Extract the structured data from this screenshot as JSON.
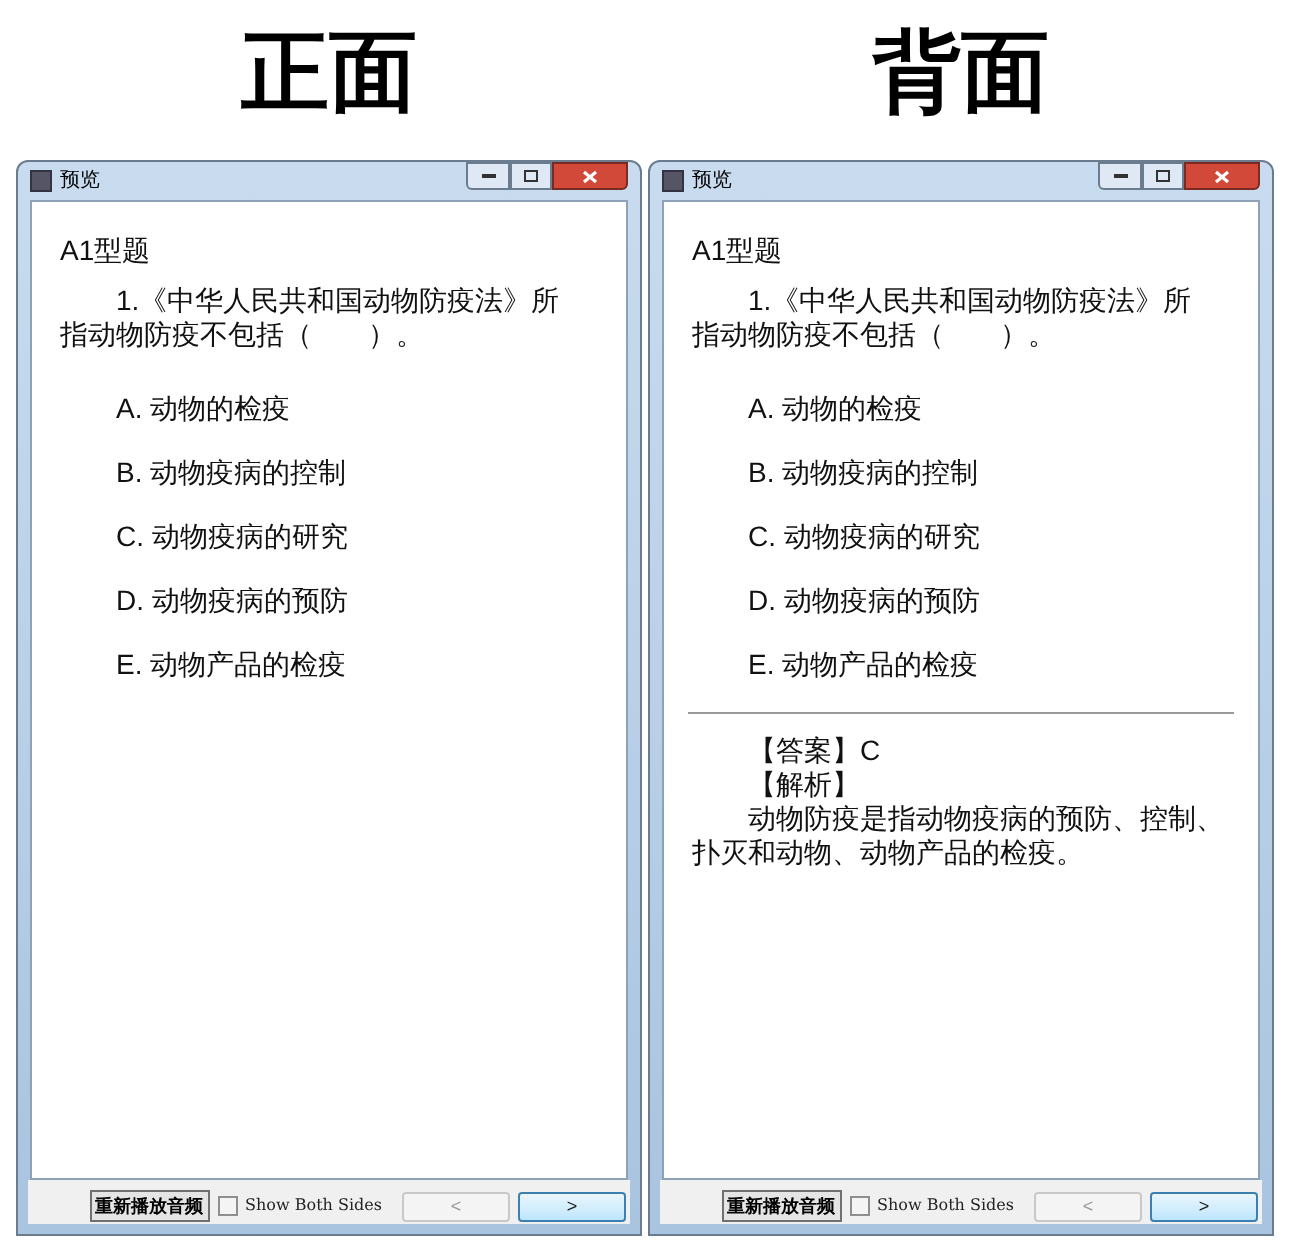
{
  "panels": [
    {
      "heading": "正面",
      "window": {
        "title": "预览",
        "section": "A1型题",
        "question": "1.《中华人民共和国动物防疫法》所指动物防疫不包括（　　）。",
        "options": [
          "A. 动物的检疫",
          "B. 动物疫病的控制",
          "C. 动物疫病的研究",
          "D. 动物疫病的预防",
          "E. 动物产品的检疫"
        ],
        "footer": {
          "replay": "重新播放音频",
          "show_both": {
            "label": "Show Both Sides",
            "checked": false
          },
          "prev": {
            "label": "<",
            "disabled": true
          },
          "next": {
            "label": ">",
            "disabled": false
          }
        }
      }
    },
    {
      "heading": "背面",
      "window": {
        "title": "预览",
        "section": "A1型题",
        "question": "1.《中华人民共和国动物防疫法》所指动物防疫不包括（　　）。",
        "options": [
          "A. 动物的检疫",
          "B. 动物疫病的控制",
          "C. 动物疫病的研究",
          "D. 动物疫病的预防",
          "E. 动物产品的检疫"
        ],
        "back": {
          "answer_label": "【答案】",
          "answer": "C",
          "explanation_label": "【解析】",
          "explanation": "动物防疫是指动物疫病的预防、控制、扑灭和动物、动物产品的检疫。"
        },
        "footer": {
          "replay": "重新播放音频",
          "show_both": {
            "label": "Show Both Sides",
            "checked": false
          },
          "prev": {
            "label": "<",
            "disabled": true
          },
          "next": {
            "label": ">",
            "disabled": false
          }
        }
      }
    }
  ]
}
